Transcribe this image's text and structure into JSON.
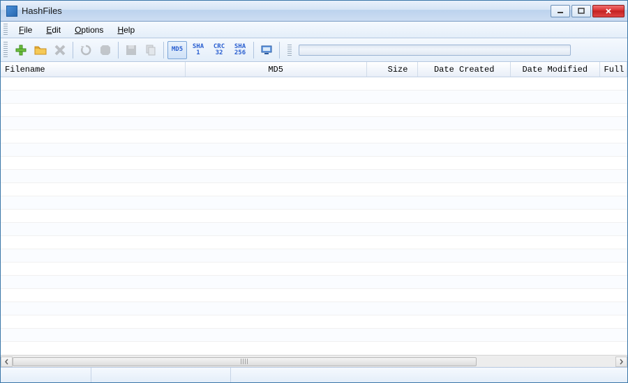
{
  "window": {
    "title": "HashFiles"
  },
  "menu": {
    "file": "File",
    "edit": "Edit",
    "options": "Options",
    "help": "Help"
  },
  "toolbar": {
    "hash_modes": {
      "md5": {
        "line1": "MD5",
        "line2": ""
      },
      "sha1": {
        "line1": "SHA",
        "line2": "1"
      },
      "crc32": {
        "line1": "CRC",
        "line2": "32"
      },
      "sha256": {
        "line1": "SHA",
        "line2": "256"
      }
    },
    "active_mode": "md5"
  },
  "columns": {
    "filename": "Filename",
    "md5": "MD5",
    "size": "Size",
    "date_created": "Date Created",
    "date_modified": "Date Modified",
    "full": "Full"
  },
  "column_widths": {
    "filename": 270,
    "md5": 265,
    "size": 75,
    "date_created": 135,
    "date_modified": 130,
    "full": 40
  },
  "rows": []
}
